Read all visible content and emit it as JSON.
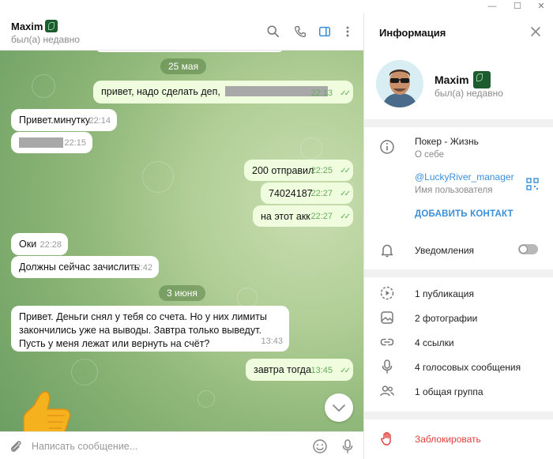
{
  "window": {
    "minimize": "—",
    "maximize": "☐",
    "close": "✕"
  },
  "chat": {
    "name": "Maxim",
    "status": "был(а) недавно",
    "messages": [
      {
        "date": "25 мая"
      },
      {
        "dir": "out",
        "text": "привет, надо сделать деп,",
        "time": "22:13"
      },
      {
        "dir": "in",
        "text": "Привет.минутку",
        "time": "22:14"
      },
      {
        "dir": "in",
        "text": "",
        "time": "22:15"
      },
      {
        "dir": "out",
        "text": "200 отправил",
        "time": "22:25"
      },
      {
        "dir": "out",
        "text": "74024187",
        "time": "22:27"
      },
      {
        "dir": "out",
        "text": "на этот акк",
        "time": "22:27"
      },
      {
        "dir": "in",
        "text": "Оки",
        "time": "22:28"
      },
      {
        "dir": "in",
        "text": "Должны сейчас зачислить",
        "time": "22:42"
      },
      {
        "date": "3 июня"
      },
      {
        "dir": "in",
        "text": "Привет. Деньги снял у тебя со счета. Но у них лимиты закончились уже на выводы. Завтра только выведут. Пусть у меня лежат или вернуть на счёт?",
        "time": "13:43"
      },
      {
        "dir": "out",
        "text": "завтра тогда",
        "time": "13:45"
      }
    ],
    "compose_placeholder": "Написать сообщение..."
  },
  "info": {
    "title": "Информация",
    "name": "Maxim",
    "status": "был(а) недавно",
    "bio": "Покер - Жизнь",
    "bio_label": "О себе",
    "username": "@LuckyRiver_manager",
    "username_label": "Имя пользователя",
    "add_contact": "ДОБАВИТЬ КОНТАКТ",
    "notifications": "Уведомления",
    "notifications_on": false,
    "media": [
      {
        "icon": "publication-icon",
        "label": "1 публикация"
      },
      {
        "icon": "photo-icon",
        "label": "2 фотографии"
      },
      {
        "icon": "link-icon",
        "label": "4 ссылки"
      },
      {
        "icon": "microphone-icon",
        "label": "4 голосовых сообщения"
      },
      {
        "icon": "group-icon",
        "label": "1 общая группа"
      }
    ],
    "block": "Заблокировать"
  },
  "colors": {
    "accent": "#3a8fd9",
    "danger": "#e0403d",
    "outgoing": "#effdde",
    "check": "#5db05b"
  }
}
